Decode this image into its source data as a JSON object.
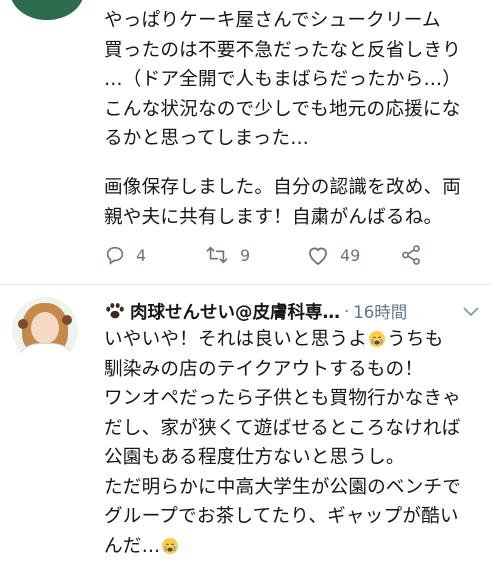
{
  "tweet1": {
    "avatar_icon": "avatar-green",
    "text_lines_1": [
      "やっぱりケーキ屋さんでシュークリーム",
      "買ったのは不要不急だったなと反省しきり",
      "…（ドア全開で人もまばらだったから…）",
      "こんな状況なので少しでも地元の応援にな",
      "るかと思ってしまった…"
    ],
    "text_lines_2": [
      "画像保存しました。自分の認識を改め、両",
      "親や夫に共有します！自粛がんばるね。"
    ],
    "actions": {
      "reply_count": "4",
      "retweet_count": "9",
      "like_count": "49"
    }
  },
  "tweet2": {
    "display_name": "肉球せんせい@皮膚科専…",
    "separator": " · ",
    "time": "16時間",
    "lines": [
      {
        "before": "いやいや！それは良いと思うよ",
        "emoji": "crying-face",
        "after": "うちも"
      },
      {
        "before": "馴染みの店のテイクアウトするもの！",
        "emoji": null,
        "after": ""
      },
      {
        "before": "ワンオペだったら子供とも買物行かなきゃ",
        "emoji": null,
        "after": ""
      },
      {
        "before": "だし、家が狭くて遊ばせるところなければ",
        "emoji": null,
        "after": ""
      },
      {
        "before": "公園もある程度仕方ないと思うし。",
        "emoji": null,
        "after": ""
      },
      {
        "before": "ただ明らかに中高大学生が公園のベンチで",
        "emoji": null,
        "after": ""
      },
      {
        "before": "グループでお茶してたり、ギャップが酷い",
        "emoji": null,
        "after": ""
      },
      {
        "before": "んだ…",
        "emoji": "crying-face",
        "after": ""
      }
    ]
  },
  "colors": {
    "text": "#14171a",
    "muted": "#657786",
    "divider": "#e6ecf0"
  }
}
